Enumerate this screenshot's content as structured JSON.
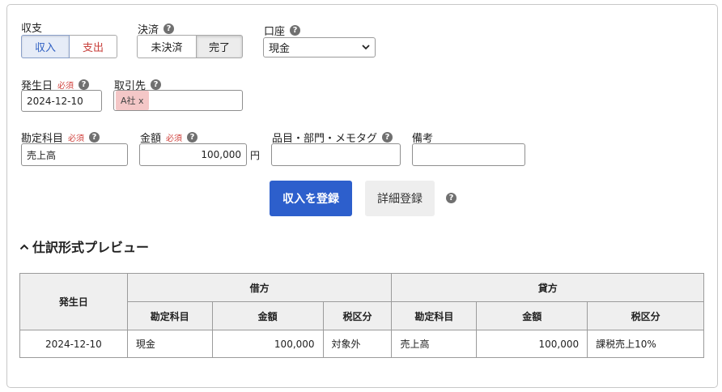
{
  "form": {
    "type": {
      "label": "収支",
      "income": "収入",
      "expense": "支出"
    },
    "settlement": {
      "label": "決済",
      "unsettled": "未決済",
      "completed": "完了"
    },
    "account": {
      "label": "口座",
      "value": "現金"
    },
    "issue_date": {
      "label": "発生日",
      "required": "必須",
      "value": "2024-12-10"
    },
    "partner": {
      "label": "取引先",
      "tag": "A社",
      "tag_remove": "x"
    },
    "account_item": {
      "label": "勘定科目",
      "required": "必須",
      "value": "売上高"
    },
    "amount": {
      "label": "金額",
      "required": "必須",
      "value": "100,000",
      "unit": "円"
    },
    "item_tags": {
      "label": "品目・部門・メモタグ",
      "value": ""
    },
    "memo": {
      "label": "備考",
      "value": ""
    },
    "help_glyph": "?",
    "submit_label": "収入を登録",
    "detail_label": "詳細登録"
  },
  "preview": {
    "title": "仕訳形式プレビュー",
    "collapse_icon": "chevron-up-icon",
    "headers": {
      "date": "発生日",
      "debit": "借方",
      "credit": "貸方",
      "account": "勘定科目",
      "amount": "金額",
      "tax": "税区分"
    },
    "rows": [
      {
        "date": "2024-12-10",
        "debit_account": "現金",
        "debit_amount": "100,000",
        "debit_tax": "対象外",
        "credit_account": "売上高",
        "credit_amount": "100,000",
        "credit_tax": "課税売上10%"
      }
    ]
  },
  "colors": {
    "primary": "#2d5fcc",
    "income_text": "#2d5ec2",
    "expense_text": "#c8413c",
    "required": "#d0413c",
    "tag_bg": "#f4c7c7"
  }
}
